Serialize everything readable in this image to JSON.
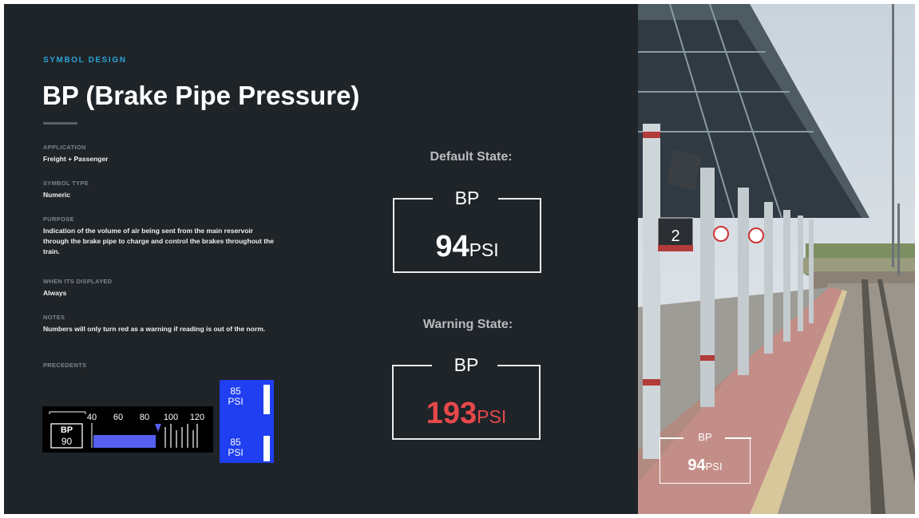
{
  "eyebrow": "SYMBOL DESIGN",
  "title": "BP (Brake Pipe Pressure)",
  "fields": [
    {
      "label": "APPLICATION",
      "value": "Freight + Passenger"
    },
    {
      "label": "SYMBOL TYPE",
      "value": "Numeric"
    },
    {
      "label": "PURPOSE",
      "value": "Indication of the volume of air being sent from the main reservoir through the brake pipe to charge and control the brakes throughout the train."
    },
    {
      "label": "WHEN ITS DISPLAYED",
      "value": "Always"
    },
    {
      "label": "NOTES",
      "value": "Numbers will only turn red as a warning if reading is out of the norm."
    },
    {
      "label": "PRECEDENTS",
      "value": ""
    }
  ],
  "default_state": {
    "heading": "Default State:",
    "label": "BP",
    "value": "94",
    "unit": "PSI"
  },
  "warning_state": {
    "heading": "Warning State:",
    "label": "BP",
    "value": "193",
    "unit": "PSI"
  },
  "precedent_a": {
    "label": "BP",
    "value": "90",
    "ticks": [
      "40",
      "60",
      "80",
      "100",
      "120"
    ],
    "level_fraction": 0.5
  },
  "precedent_b": {
    "top_value": "85",
    "top_unit": "PSI",
    "bottom_value": "85",
    "bottom_unit": "PSI"
  },
  "photo": {
    "platform_sign": "2",
    "overlay_label": "BP",
    "overlay_value": "94",
    "overlay_unit": "PSI"
  },
  "colors": {
    "accent": "#2aa3d8",
    "warning": "#e8484a",
    "background": "#1f2428",
    "precedent_blue": "#1f3ff0"
  }
}
